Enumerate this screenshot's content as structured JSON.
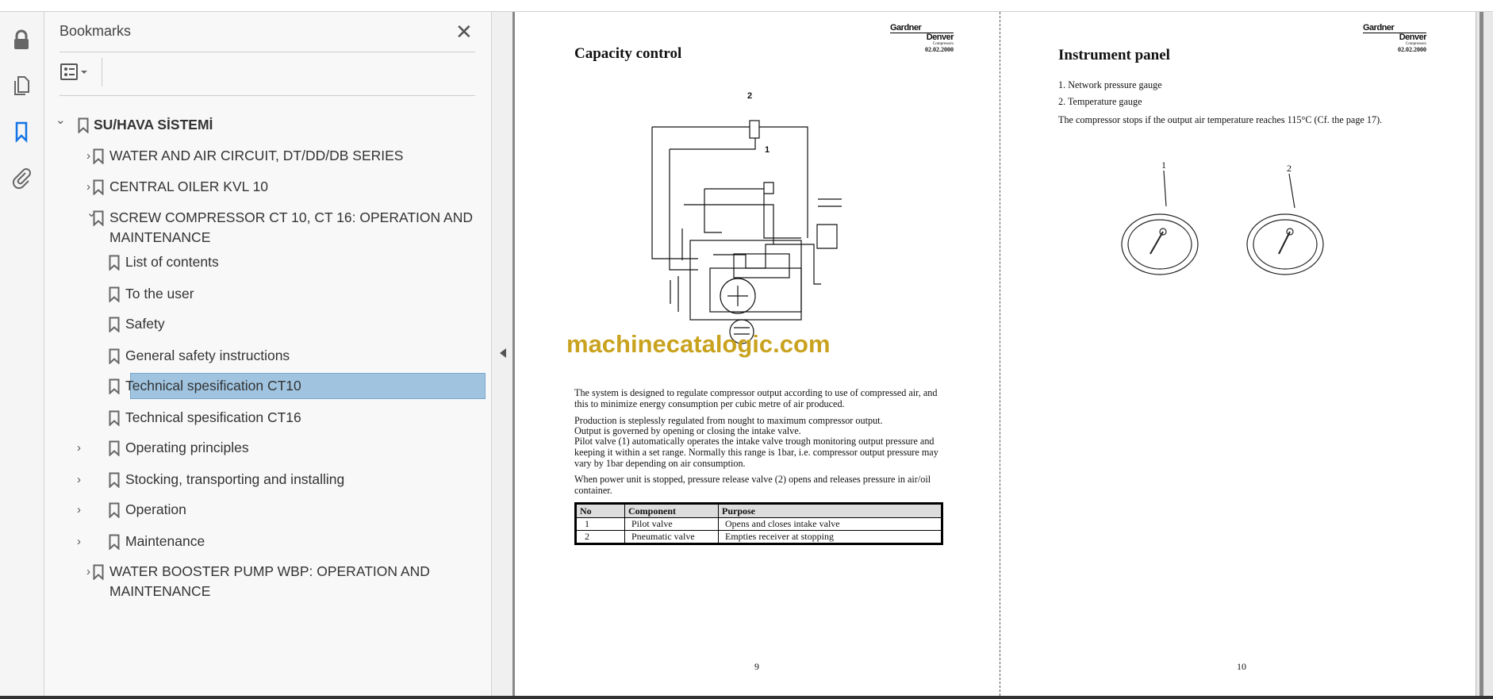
{
  "sidebar_rail": {
    "icons": [
      "lock-icon",
      "pages-icon",
      "bookmark-icon",
      "attachment-icon"
    ]
  },
  "bookmarks": {
    "title": "Bookmarks",
    "close": "✕",
    "items": [
      {
        "label": "SU/HAVA SİSTEMİ",
        "level": 0,
        "chev": "⌄"
      },
      {
        "label": "WATER AND AIR CIRCUIT, DT/DD/DB SERIES",
        "level": 1,
        "chev": "›"
      },
      {
        "label": "CENTRAL OILER KVL 10",
        "level": 1,
        "chev": "›"
      },
      {
        "label": "SCREW COMPRESSOR CT 10, CT 16: OPERATION AND",
        "label2": "MAINTENANCE",
        "level": 1,
        "chev": "⌄"
      },
      {
        "label": "List of contents",
        "level": 2
      },
      {
        "label": "To the user",
        "level": 2
      },
      {
        "label": "Safety",
        "level": 2
      },
      {
        "label": "General safety instructions",
        "level": 2
      },
      {
        "label": "Technical spesification CT10",
        "level": 2,
        "selected": true
      },
      {
        "label": "Technical spesification CT16",
        "level": 2
      },
      {
        "label": "Operating principles",
        "level": 2,
        "chev": "›"
      },
      {
        "label": "Stocking, transporting and installing",
        "level": 2,
        "chev": "›"
      },
      {
        "label": "Operation",
        "level": 2,
        "chev": "›"
      },
      {
        "label": "Maintenance",
        "level": 2,
        "chev": "›"
      },
      {
        "label": "WATER BOOSTER PUMP WBP: OPERATION AND",
        "label2": "MAINTENANCE",
        "level": 1,
        "chev": "›"
      }
    ]
  },
  "logo": {
    "line1": "Gardner",
    "line2": "Denver",
    "sub": "Compressors",
    "date": "02.02.2000"
  },
  "page9": {
    "title": "Capacity control",
    "diagram_labels": [
      "2",
      "1"
    ],
    "watermark": "machinecatalogic.com",
    "paragraphs": [
      "The system is designed to regulate compressor output according to use of compressed air, and this to minimize energy consumption per cubic metre of air produced.",
      "Production is steplessly regulated from nought to maximum compressor output.",
      "Output is governed by opening or closing the intake valve.",
      "Pilot valve (1) automatically operates the intake valve trough monitoring output pressure and keeping it within a set range. Normally this range is 1bar, i.e. compressor output pressure may vary by 1bar depending on air consumption.",
      "When power unit is stopped, pressure release valve (2) opens and releases pressure in air/oil container."
    ],
    "table": {
      "headers": [
        "No",
        "Component",
        "Purpose"
      ],
      "rows": [
        [
          "1",
          "Pilot valve",
          "Opens and closes intake valve"
        ],
        [
          "2",
          "Pneumatic valve",
          "Empties receiver at stopping"
        ]
      ]
    },
    "page_number": "9"
  },
  "page10": {
    "title": "Instrument panel",
    "items": [
      "1. Network pressure gauge",
      "2. Temperature gauge"
    ],
    "note": "The compressor stops if the output air temperature reaches 115°C (Cf. the page 17).",
    "gauge_labels": [
      "1",
      "2"
    ],
    "page_number": "10"
  }
}
